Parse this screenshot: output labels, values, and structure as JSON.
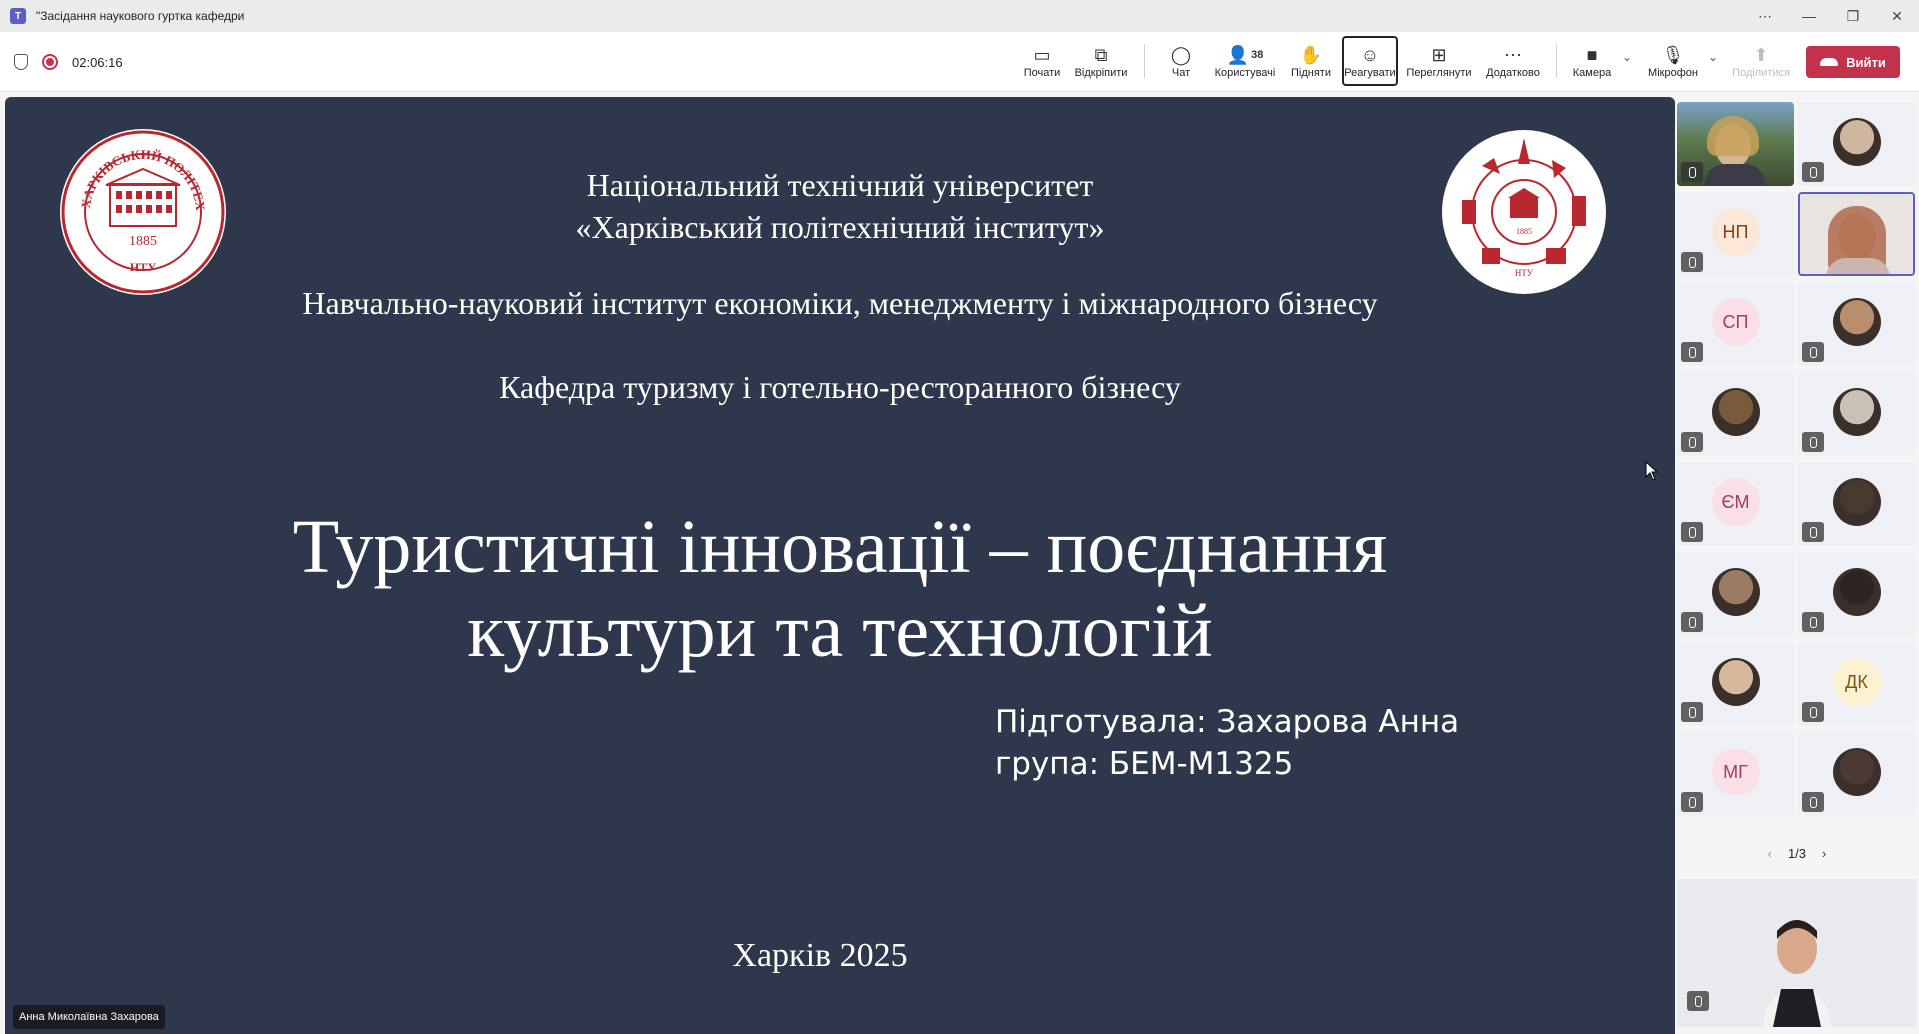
{
  "window": {
    "title": "\"Засідання наукового гуртка кафедри",
    "app_icon": "teams-icon",
    "controls": [
      "more-options",
      "minimize",
      "restore",
      "close"
    ]
  },
  "toolbar": {
    "timer": "02:06:16",
    "buttons": [
      {
        "label": "Почати",
        "icon": "share-screen-icon"
      },
      {
        "label": "Відкріпити",
        "icon": "pop-out-icon"
      },
      {
        "label": "Чат",
        "icon": "chat-icon"
      },
      {
        "label": "Користувачі",
        "icon": "people-icon",
        "count": "38"
      },
      {
        "label": "Підняти",
        "icon": "raise-hand-icon"
      },
      {
        "label": "Реагувати",
        "icon": "emoji-icon",
        "active": true
      },
      {
        "label": "Переглянути",
        "icon": "view-grid-icon"
      },
      {
        "label": "Додатково",
        "icon": "more-icon"
      },
      {
        "label": "Камера",
        "icon": "camera-off-icon"
      },
      {
        "label": "Мікрофон",
        "icon": "mic-off-icon"
      },
      {
        "label": "Поділитися",
        "icon": "share-up-icon",
        "disabled": true
      }
    ],
    "leave_label": "Вийти",
    "leave_color": "#c4314b"
  },
  "slide": {
    "university_line1": "Національний технічний університет",
    "university_line2": "«Харківський політехнічний інститут»",
    "institute": "Навчально-науковий інститут економіки, менеджменту і міжнародного бізнесу",
    "department": "Кафедра туризму і готельно-ресторанного бізнесу",
    "title_line1": "Туристичні інновації – поєднання",
    "title_line2": "культури та технологій",
    "author": "Підготувала: Захарова Анна",
    "group": "група: БЕМ-М1325",
    "city_year": "Харків 2025",
    "logo_left_text": "ХАРКІВСЬКИЙ ПОЛІТЕХНІЧНИЙ ІНСТИТУТ",
    "logo_left_year": "1885",
    "logo_left_abbr": "НТУ",
    "logo_right_abbr": "НТУ",
    "logo_right_year": "1885",
    "background": "#2f374c",
    "accent_red": "#b8282e"
  },
  "presenter_name": "Анна Миколаївна Захарова",
  "participants": [
    {
      "type": "video",
      "muted": true
    },
    {
      "type": "photo",
      "muted": true
    },
    {
      "type": "initials",
      "initials": "НП",
      "muted": true
    },
    {
      "type": "video",
      "muted": false,
      "selected": true
    },
    {
      "type": "initials",
      "initials": "СП",
      "muted": true
    },
    {
      "type": "photo",
      "muted": true
    },
    {
      "type": "photo",
      "muted": true
    },
    {
      "type": "photo",
      "muted": true
    },
    {
      "type": "initials",
      "initials": "ЄМ",
      "muted": true
    },
    {
      "type": "photo",
      "muted": true
    },
    {
      "type": "photo",
      "muted": true
    },
    {
      "type": "photo",
      "muted": true
    },
    {
      "type": "photo",
      "muted": true
    },
    {
      "type": "initials",
      "initials": "ДК",
      "muted": true
    },
    {
      "type": "initials",
      "initials": "МГ",
      "muted": true
    },
    {
      "type": "photo",
      "muted": true
    }
  ],
  "pager": {
    "text": "1/3"
  }
}
